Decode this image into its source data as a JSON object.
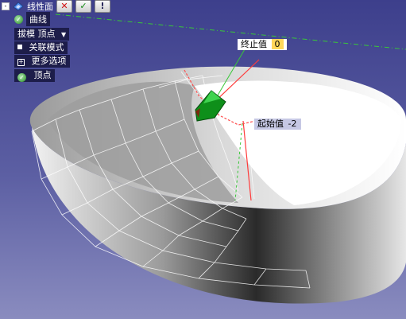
{
  "feature": {
    "title": "线性面",
    "tree_toggle": "-",
    "icon": "ruled-surface-icon",
    "buttons": [
      {
        "name": "cancel",
        "icon": "x-icon",
        "glyph": "✕"
      },
      {
        "name": "ok",
        "icon": "check-icon",
        "glyph": "✓"
      },
      {
        "name": "help",
        "icon": "help-icon",
        "glyph": "!"
      }
    ]
  },
  "curve_item": {
    "label": "曲线"
  },
  "draft_dropdown": {
    "value": "拔模 顶点"
  },
  "assoc_mode": {
    "label": "关联模式"
  },
  "more_options": {
    "label": "更多选项",
    "toggle": "+"
  },
  "vertex_item": {
    "label": "顶点"
  },
  "end_value": {
    "label": "终止值",
    "value": "0"
  },
  "start_value": {
    "label": "起始值",
    "value": "-2"
  },
  "colors": {
    "background": "#5c5fa3",
    "label_bg": "#1d1d4a",
    "end_highlight": "#ffd75a",
    "axis_red": "#ff3a3a",
    "axis_green": "#38c838",
    "handle_green": "#0e8f1a"
  }
}
